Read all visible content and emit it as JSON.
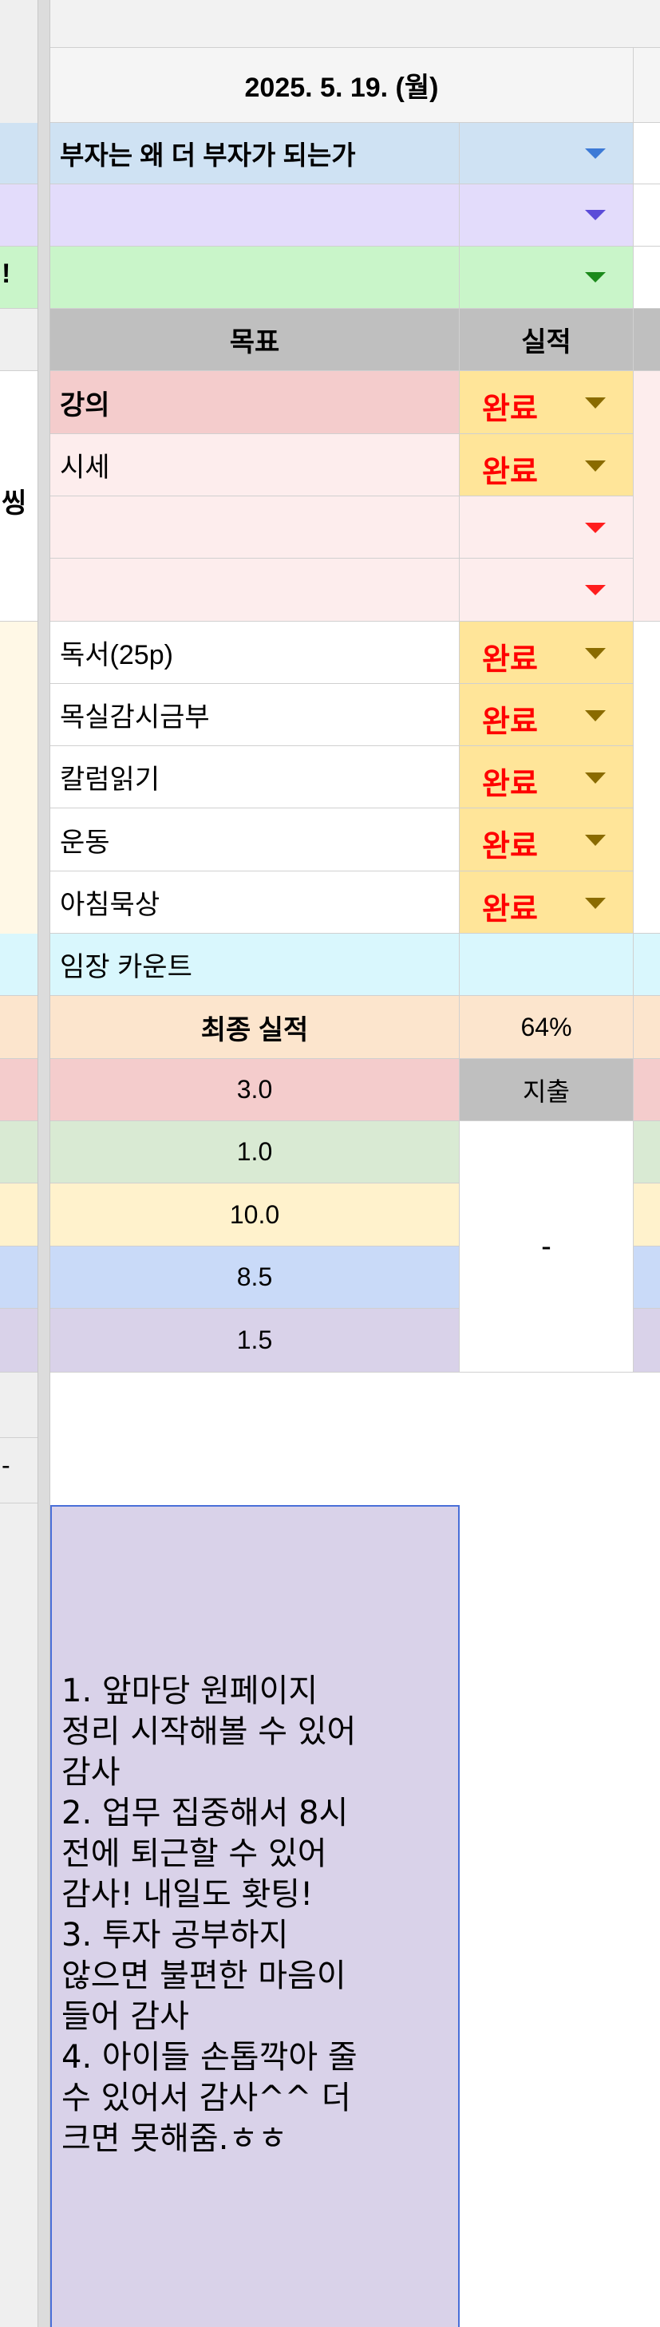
{
  "header": {
    "date": "2025. 5. 19. (월)"
  },
  "left_partial": {
    "text_a": "!",
    "text_b": "씽",
    "text_c": "-"
  },
  "top_rows": [
    {
      "text": "부자는 왜 더 부자가 되는가",
      "color": "#cfe2f3",
      "arrow": "blue"
    },
    {
      "text": "",
      "color": "#e3dcfb",
      "arrow": "purple"
    },
    {
      "text": "",
      "color": "#c9f5c9",
      "arrow": "green"
    }
  ],
  "table_header": {
    "goal": "목표",
    "result": "실적"
  },
  "tasks": [
    {
      "label": "강의",
      "bold": true,
      "status": "완료",
      "row_color": "#f4cccc"
    },
    {
      "label": "시세",
      "bold": false,
      "status": "완료",
      "row_color": "#fdeded"
    },
    {
      "label": "",
      "bold": false,
      "status": "",
      "row_color": "#fdeded"
    },
    {
      "label": "",
      "bold": false,
      "status": "",
      "row_color": "#fdeded"
    },
    {
      "label": "독서(25p)",
      "bold": false,
      "status": "완료",
      "row_color": "#ffffff"
    },
    {
      "label": "목실감시금부",
      "bold": false,
      "status": "완료",
      "row_color": "#ffffff"
    },
    {
      "label": "칼럼읽기",
      "bold": false,
      "status": "완료",
      "row_color": "#ffffff"
    },
    {
      "label": "운동",
      "bold": false,
      "status": "완료",
      "row_color": "#ffffff"
    },
    {
      "label": "아침묵상",
      "bold": false,
      "status": "완료",
      "row_color": "#ffffff"
    }
  ],
  "imjang": {
    "label": "임장 카운트",
    "value": ""
  },
  "final": {
    "label": "최종 실적",
    "value": "64%"
  },
  "numbers": [
    {
      "value": "3.0",
      "color": "#f4cccc"
    },
    {
      "value": "1.0",
      "color": "#d9ead3"
    },
    {
      "value": "10.0",
      "color": "#fff2cc"
    },
    {
      "value": "8.5",
      "color": "#c9daf8"
    },
    {
      "value": "1.5",
      "color": "#d9d2e9"
    }
  ],
  "expense": {
    "label": "지출",
    "value": "-"
  },
  "gratitude": {
    "text": "1. 앞마당 원페이지 정리 시작해볼 수 있어 감사\n2. 업무 집중해서 8시 전에 퇴근할 수 있어 감사! 내일도 홧팅!\n3. 투자 공부하지 않으면 불편한 마음이 들어 감사\n4. 아이들 손톱깍아 줄 수 있어서 감사^^ 더 크면 못해줌.ㅎㅎ",
    "lines": [
      "1. 앞마당 원페이지",
      "정리 시작해볼 수 있어",
      "감사",
      "2. 업무 집중해서 8시",
      "전에 퇴근할 수 있어",
      "감사! 내일도 홧팅!",
      "3. 투자 공부하지",
      "않으면 불편한 마음이",
      "들어 감사",
      "4. 아이들 손톱깍아 줄",
      "수 있어서 감사^^ 더",
      "크면 못해줌.ㅎㅎ"
    ]
  }
}
